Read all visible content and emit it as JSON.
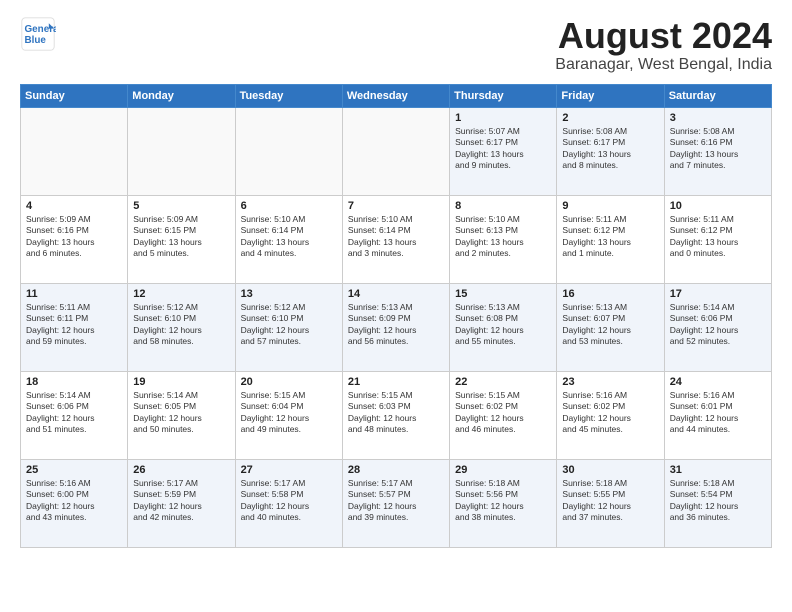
{
  "header": {
    "logo_line1": "General",
    "logo_line2": "Blue",
    "title": "August 2024",
    "location": "Baranagar, West Bengal, India"
  },
  "days_of_week": [
    "Sunday",
    "Monday",
    "Tuesday",
    "Wednesday",
    "Thursday",
    "Friday",
    "Saturday"
  ],
  "weeks": [
    [
      {
        "day": "",
        "info": ""
      },
      {
        "day": "",
        "info": ""
      },
      {
        "day": "",
        "info": ""
      },
      {
        "day": "",
        "info": ""
      },
      {
        "day": "1",
        "info": "Sunrise: 5:07 AM\nSunset: 6:17 PM\nDaylight: 13 hours\nand 9 minutes."
      },
      {
        "day": "2",
        "info": "Sunrise: 5:08 AM\nSunset: 6:17 PM\nDaylight: 13 hours\nand 8 minutes."
      },
      {
        "day": "3",
        "info": "Sunrise: 5:08 AM\nSunset: 6:16 PM\nDaylight: 13 hours\nand 7 minutes."
      }
    ],
    [
      {
        "day": "4",
        "info": "Sunrise: 5:09 AM\nSunset: 6:16 PM\nDaylight: 13 hours\nand 6 minutes."
      },
      {
        "day": "5",
        "info": "Sunrise: 5:09 AM\nSunset: 6:15 PM\nDaylight: 13 hours\nand 5 minutes."
      },
      {
        "day": "6",
        "info": "Sunrise: 5:10 AM\nSunset: 6:14 PM\nDaylight: 13 hours\nand 4 minutes."
      },
      {
        "day": "7",
        "info": "Sunrise: 5:10 AM\nSunset: 6:14 PM\nDaylight: 13 hours\nand 3 minutes."
      },
      {
        "day": "8",
        "info": "Sunrise: 5:10 AM\nSunset: 6:13 PM\nDaylight: 13 hours\nand 2 minutes."
      },
      {
        "day": "9",
        "info": "Sunrise: 5:11 AM\nSunset: 6:12 PM\nDaylight: 13 hours\nand 1 minute."
      },
      {
        "day": "10",
        "info": "Sunrise: 5:11 AM\nSunset: 6:12 PM\nDaylight: 13 hours\nand 0 minutes."
      }
    ],
    [
      {
        "day": "11",
        "info": "Sunrise: 5:11 AM\nSunset: 6:11 PM\nDaylight: 12 hours\nand 59 minutes."
      },
      {
        "day": "12",
        "info": "Sunrise: 5:12 AM\nSunset: 6:10 PM\nDaylight: 12 hours\nand 58 minutes."
      },
      {
        "day": "13",
        "info": "Sunrise: 5:12 AM\nSunset: 6:10 PM\nDaylight: 12 hours\nand 57 minutes."
      },
      {
        "day": "14",
        "info": "Sunrise: 5:13 AM\nSunset: 6:09 PM\nDaylight: 12 hours\nand 56 minutes."
      },
      {
        "day": "15",
        "info": "Sunrise: 5:13 AM\nSunset: 6:08 PM\nDaylight: 12 hours\nand 55 minutes."
      },
      {
        "day": "16",
        "info": "Sunrise: 5:13 AM\nSunset: 6:07 PM\nDaylight: 12 hours\nand 53 minutes."
      },
      {
        "day": "17",
        "info": "Sunrise: 5:14 AM\nSunset: 6:06 PM\nDaylight: 12 hours\nand 52 minutes."
      }
    ],
    [
      {
        "day": "18",
        "info": "Sunrise: 5:14 AM\nSunset: 6:06 PM\nDaylight: 12 hours\nand 51 minutes."
      },
      {
        "day": "19",
        "info": "Sunrise: 5:14 AM\nSunset: 6:05 PM\nDaylight: 12 hours\nand 50 minutes."
      },
      {
        "day": "20",
        "info": "Sunrise: 5:15 AM\nSunset: 6:04 PM\nDaylight: 12 hours\nand 49 minutes."
      },
      {
        "day": "21",
        "info": "Sunrise: 5:15 AM\nSunset: 6:03 PM\nDaylight: 12 hours\nand 48 minutes."
      },
      {
        "day": "22",
        "info": "Sunrise: 5:15 AM\nSunset: 6:02 PM\nDaylight: 12 hours\nand 46 minutes."
      },
      {
        "day": "23",
        "info": "Sunrise: 5:16 AM\nSunset: 6:02 PM\nDaylight: 12 hours\nand 45 minutes."
      },
      {
        "day": "24",
        "info": "Sunrise: 5:16 AM\nSunset: 6:01 PM\nDaylight: 12 hours\nand 44 minutes."
      }
    ],
    [
      {
        "day": "25",
        "info": "Sunrise: 5:16 AM\nSunset: 6:00 PM\nDaylight: 12 hours\nand 43 minutes."
      },
      {
        "day": "26",
        "info": "Sunrise: 5:17 AM\nSunset: 5:59 PM\nDaylight: 12 hours\nand 42 minutes."
      },
      {
        "day": "27",
        "info": "Sunrise: 5:17 AM\nSunset: 5:58 PM\nDaylight: 12 hours\nand 40 minutes."
      },
      {
        "day": "28",
        "info": "Sunrise: 5:17 AM\nSunset: 5:57 PM\nDaylight: 12 hours\nand 39 minutes."
      },
      {
        "day": "29",
        "info": "Sunrise: 5:18 AM\nSunset: 5:56 PM\nDaylight: 12 hours\nand 38 minutes."
      },
      {
        "day": "30",
        "info": "Sunrise: 5:18 AM\nSunset: 5:55 PM\nDaylight: 12 hours\nand 37 minutes."
      },
      {
        "day": "31",
        "info": "Sunrise: 5:18 AM\nSunset: 5:54 PM\nDaylight: 12 hours\nand 36 minutes."
      }
    ]
  ]
}
